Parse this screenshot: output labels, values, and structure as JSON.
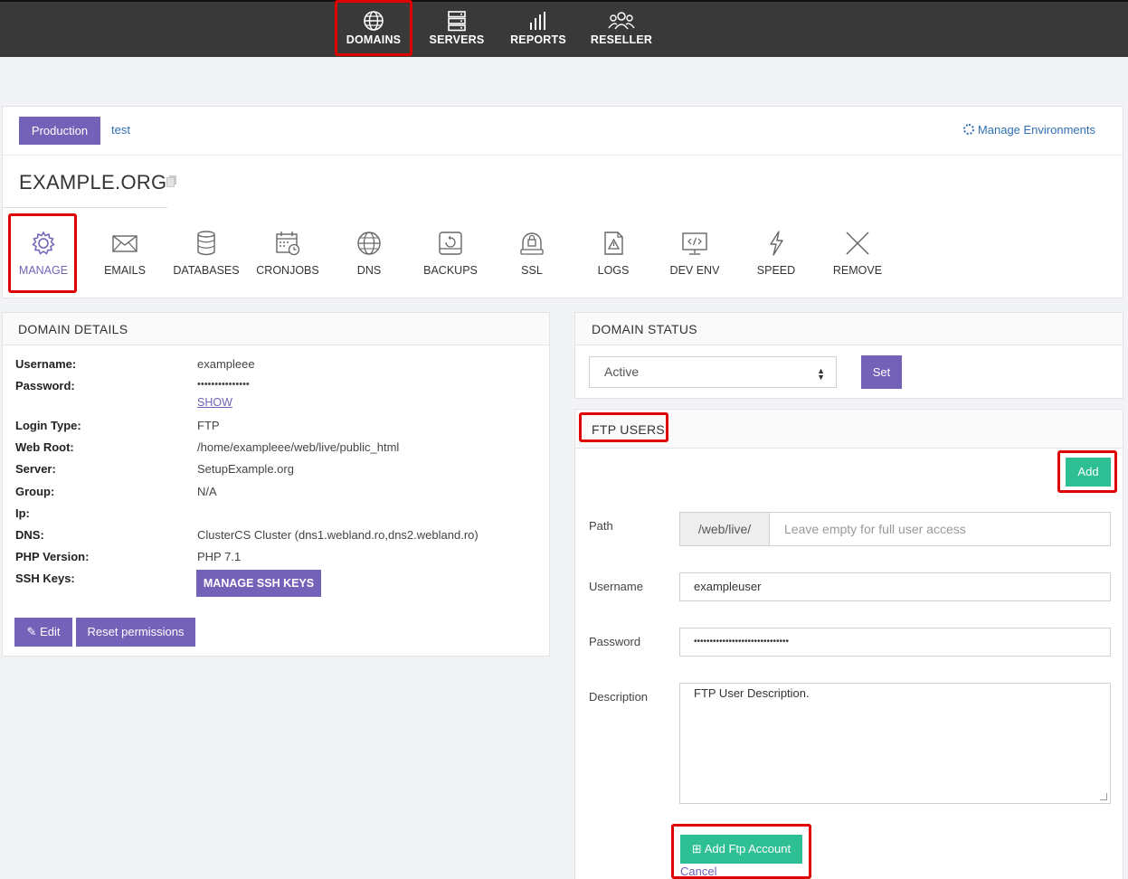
{
  "nav": {
    "items": [
      {
        "label": "DOMAINS",
        "icon": "globe-icon"
      },
      {
        "label": "SERVERS",
        "icon": "server-icon"
      },
      {
        "label": "REPORTS",
        "icon": "bar-chart-icon"
      },
      {
        "label": "RESELLER",
        "icon": "users-icon"
      }
    ]
  },
  "environments": {
    "tabs": [
      "Production",
      "test"
    ],
    "manage_label": "Manage Environments"
  },
  "domain": {
    "title": "EXAMPLE.ORG"
  },
  "tools": [
    {
      "label": "MANAGE",
      "icon": "gear-icon"
    },
    {
      "label": "EMAILS",
      "icon": "envelope-icon"
    },
    {
      "label": "DATABASES",
      "icon": "database-icon"
    },
    {
      "label": "CRONJOBS",
      "icon": "calendar-icon"
    },
    {
      "label": "DNS",
      "icon": "globe-icon"
    },
    {
      "label": "BACKUPS",
      "icon": "backup-drive-icon"
    },
    {
      "label": "SSL",
      "icon": "ssl-lock-icon"
    },
    {
      "label": "LOGS",
      "icon": "log-file-icon"
    },
    {
      "label": "DEV ENV",
      "icon": "monitor-code-icon"
    },
    {
      "label": "SPEED",
      "icon": "lightning-icon"
    },
    {
      "label": "REMOVE",
      "icon": "close-icon"
    }
  ],
  "details": {
    "heading": "DOMAIN DETAILS",
    "rows": [
      {
        "label": "Username:",
        "value": "exampleee"
      },
      {
        "label": "Password:",
        "value": "•••••••••••••••"
      },
      {
        "label": "Login Type:",
        "value": "FTP"
      },
      {
        "label": "Web Root:",
        "value": "/home/exampleee/web/live/public_html"
      },
      {
        "label": "Server:",
        "value": "SetupExample.org"
      },
      {
        "label": "Group:",
        "value": "N/A"
      },
      {
        "label": "Ip:",
        "value": ""
      },
      {
        "label": "DNS:",
        "value": "ClusterCS Cluster (dns1.webland.ro,dns2.webland.ro)"
      },
      {
        "label": "PHP Version:",
        "value": "PHP 7.1"
      },
      {
        "label": "SSH Keys:",
        "value": ""
      }
    ],
    "show_label": "SHOW",
    "ssh_button": "MANAGE SSH KEYS",
    "edit_button": "Edit",
    "reset_button": "Reset permissions"
  },
  "status": {
    "heading": "DOMAIN STATUS",
    "selected": "Active",
    "set_button": "Set"
  },
  "ftp": {
    "heading": "FTP USERS",
    "add_button": "Add",
    "path_label": "Path",
    "path_prefix": "/web/live/",
    "path_placeholder": "Leave empty for full user access",
    "username_label": "Username",
    "username_value": "exampleuser",
    "password_label": "Password",
    "password_value": "••••••••••••••••••••••••••••••",
    "description_label": "Description",
    "description_value": "FTP User Description.",
    "submit_button": "Add Ftp Account",
    "cancel_label": "Cancel"
  },
  "colors": {
    "accent": "#7461b8",
    "success": "#2ebf95",
    "highlight": "#e00000",
    "topbar": "#393939"
  }
}
